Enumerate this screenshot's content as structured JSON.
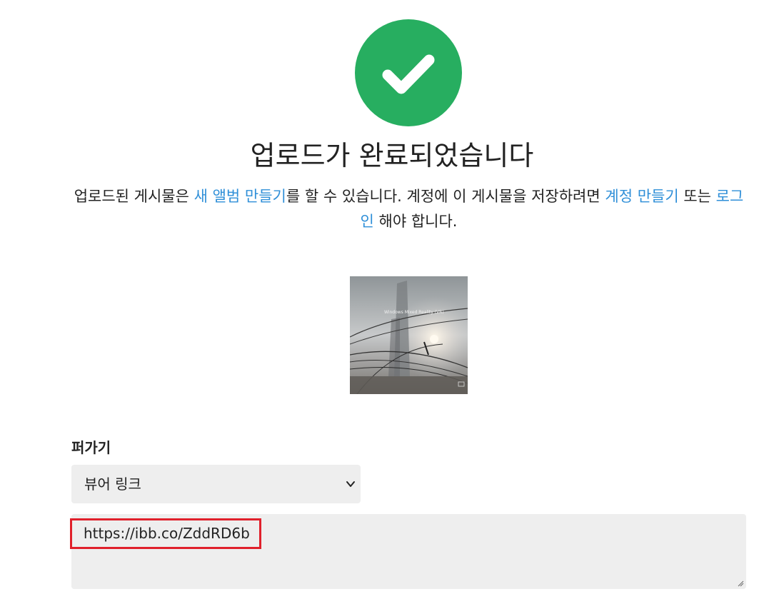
{
  "success": {
    "icon": "checkmark-icon",
    "color": "#27ae60",
    "title": "업로드가 완료되었습니다"
  },
  "description": {
    "part1": "업로드된 게시물은 ",
    "link_album": "새 앨범 만들기",
    "part2": "를 할 수 있습니다. 계정에 이 게시물을 저장하려면 ",
    "link_signup": "계정 만들기",
    "part3": " 또는 ",
    "link_login": "로그인",
    "part4": " 해야 합니다.",
    "link_color": "#2f8fd8"
  },
  "thumbnail": {
    "caption": "Windows Mixed Reality (VR)"
  },
  "embed": {
    "label": "퍼가기",
    "selected_option": "뷰어 링크",
    "link_value": "https://ibb.co/ZddRD6b",
    "highlight_color": "#e0202b"
  }
}
